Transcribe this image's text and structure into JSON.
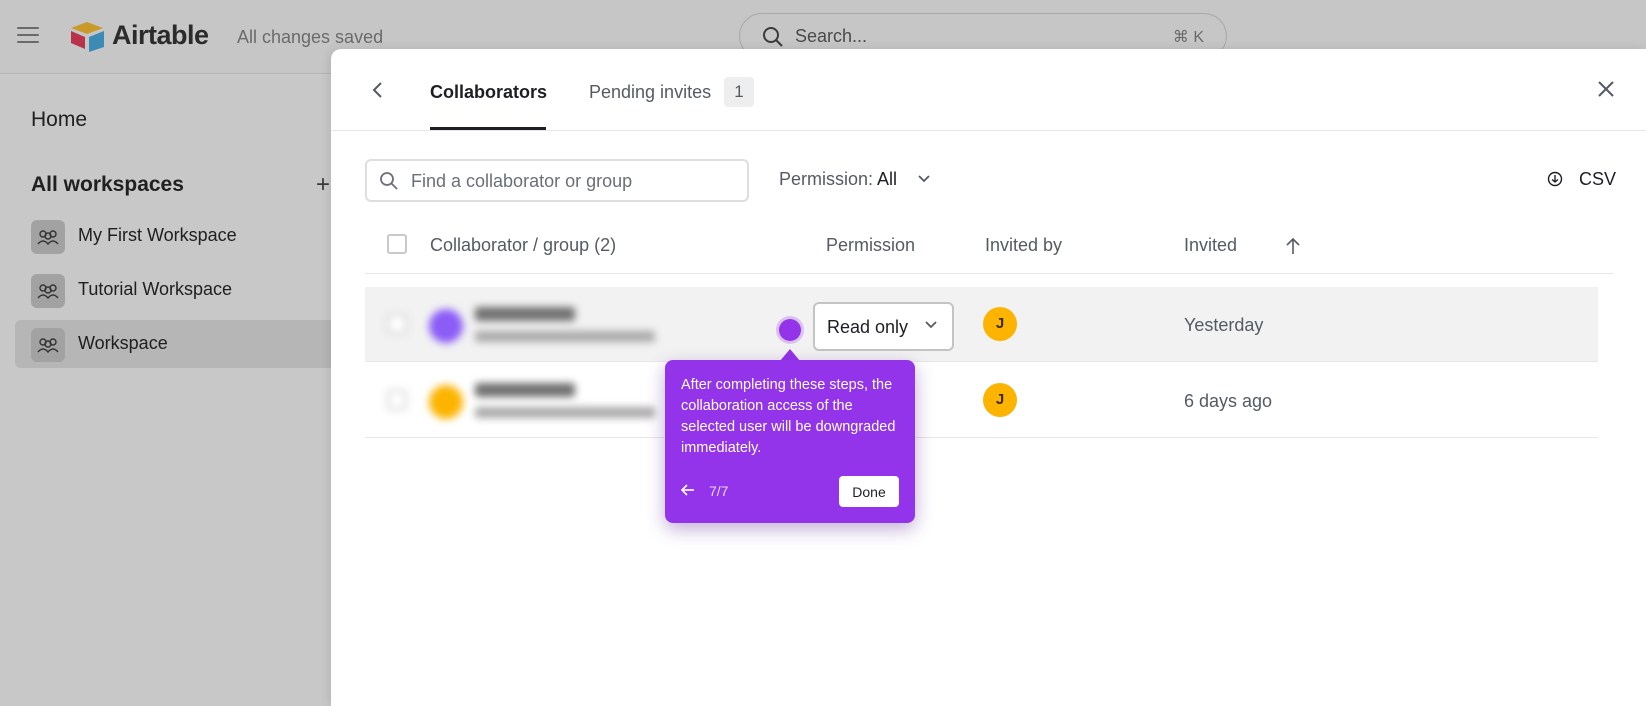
{
  "app": {
    "brand": "Airtable",
    "save_status": "All changes saved",
    "search_placeholder": "Search...",
    "search_shortcut": "⌘ K"
  },
  "sidebar": {
    "home": "Home",
    "section_title": "All workspaces",
    "add_label": "+",
    "workspaces": [
      {
        "label": "My First Workspace",
        "icon": "people-icon"
      },
      {
        "label": "Tutorial Workspace",
        "icon": "people-icon"
      },
      {
        "label": "Workspace",
        "icon": "people-icon",
        "active": true
      }
    ]
  },
  "modal": {
    "tabs": [
      {
        "label": "Collaborators",
        "active": true
      },
      {
        "label": "Pending invites",
        "count": "1"
      }
    ],
    "find_placeholder": "Find a collaborator or group",
    "permission_filter_prefix": "Permission:",
    "permission_filter_value": "All",
    "csv_label": "CSV",
    "columns": {
      "collaborator": "Collaborator / group (2)",
      "permission": "Permission",
      "invited_by": "Invited by",
      "invited": "Invited"
    },
    "rows": [
      {
        "permission": "Read only",
        "inviter_initial": "J",
        "invited": "Yesterday",
        "avatar_color": "#8b5cf6"
      },
      {
        "permission": "",
        "inviter_initial": "J",
        "invited": "6 days ago",
        "avatar_color": "#fcb400"
      }
    ]
  },
  "tooltip": {
    "text": "After completing these steps, the collaboration access of the selected user will be downgraded immediately.",
    "step": "7/7",
    "done_label": "Done",
    "color": "#9333ea"
  }
}
